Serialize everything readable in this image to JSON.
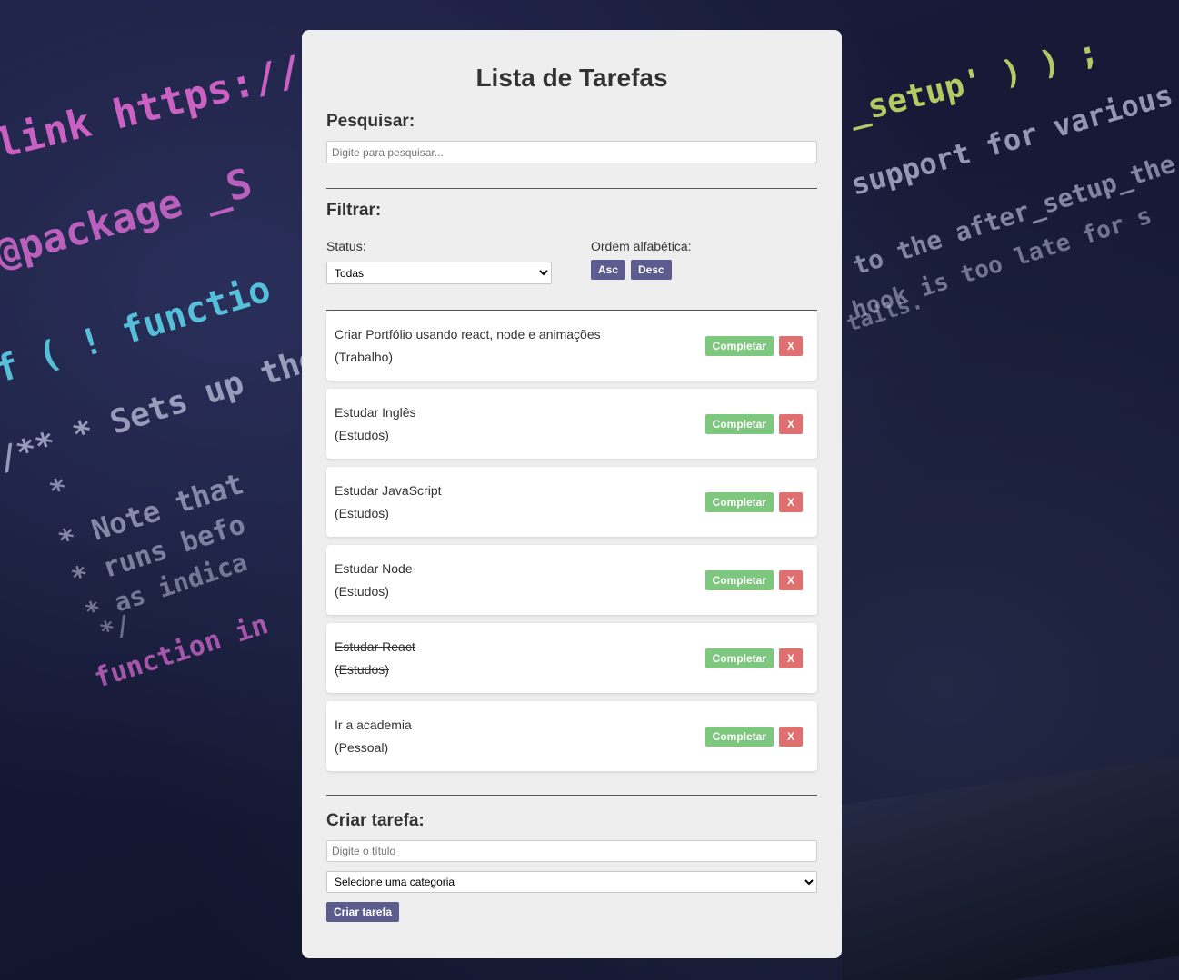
{
  "app": {
    "title": "Lista de Tarefas"
  },
  "search": {
    "heading": "Pesquisar:",
    "placeholder": "Digite para pesquisar...",
    "value": ""
  },
  "filter": {
    "heading": "Filtrar:",
    "status_label": "Status:",
    "status_selected": "Todas",
    "sort_label": "Ordem alfabética:",
    "asc_label": "Asc",
    "desc_label": "Desc"
  },
  "todos": [
    {
      "text": "Criar Portfólio usando react, node e animações",
      "category": "(Trabalho)",
      "completed": false
    },
    {
      "text": "Estudar Inglês",
      "category": "(Estudos)",
      "completed": false
    },
    {
      "text": "Estudar JavaScript",
      "category": "(Estudos)",
      "completed": false
    },
    {
      "text": "Estudar Node",
      "category": "(Estudos)",
      "completed": false
    },
    {
      "text": "Estudar React",
      "category": "(Estudos)",
      "completed": true
    },
    {
      "text": "Ir a academia",
      "category": "(Pessoal)",
      "completed": false
    }
  ],
  "todo_actions": {
    "complete_label": "Completar",
    "remove_label": "X"
  },
  "create": {
    "heading": "Criar tarefa:",
    "title_placeholder": "Digite o título",
    "category_selected": "Selecione uma categoria",
    "submit_label": "Criar tarefa"
  },
  "background": {
    "code_lines": [
      "link https://deve",
      "@package _S",
      "f ( ! functio",
      "/**  * Sets up the",
      "*",
      "* Note that",
      "* runs befo",
      "* as indica",
      "*/",
      "function in",
      "_setup' ) ) ;",
      "support for various",
      "to the after_setup_the",
      "hook is too late for s",
      "tails."
    ]
  },
  "colors": {
    "card_bg": "#eeeeee",
    "purple_button": "#5c5c8e",
    "green_button": "#7ec77e",
    "red_button": "#e07070"
  }
}
